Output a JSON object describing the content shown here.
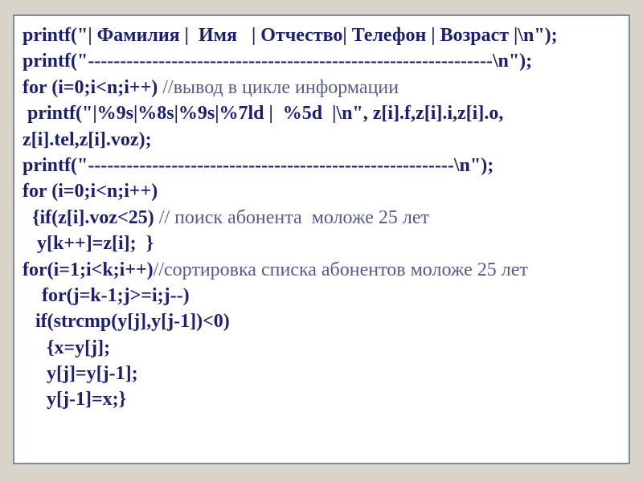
{
  "code": {
    "l1": "printf(\"| Фамилия |  Имя   | Отчество| Телефон | Возраст |\\n\");",
    "l2": "printf(\"---------------------------------------------------------------\\n\");",
    "l3a": "for (i=0;i<n;i++) ",
    "l3b": "//вывод в цикле информации",
    "l4": " printf(\"|%9s|%8s|%9s|%7ld |  %5d  |\\n\", z[i].f,z[i].i,z[i].o,",
    "l5": "z[i].tel,z[i].voz);",
    "l6": "printf(\"---------------------------------------------------------\\n\");",
    "l7": "for (i=0;i<n;i++)",
    "l8a": "  {if(z[i].voz<25) ",
    "l8b": "// поиск абонента  моложе 25 лет",
    "l9": "   y[k++]=z[i];  }",
    "l10a": "for(i=1;i<k;i++)",
    "l10b": "//сортировка списка абонентов моложе 25 лет",
    "l11": "    for(j=k-1;j>=i;j--)",
    "l12": "  if(strcmp(y[j],y[j-1])<0)  ",
    "l13": "     {x=y[j];",
    "l14": "     y[j]=y[j-1];",
    "l15": "     y[j-1]=x;}"
  }
}
